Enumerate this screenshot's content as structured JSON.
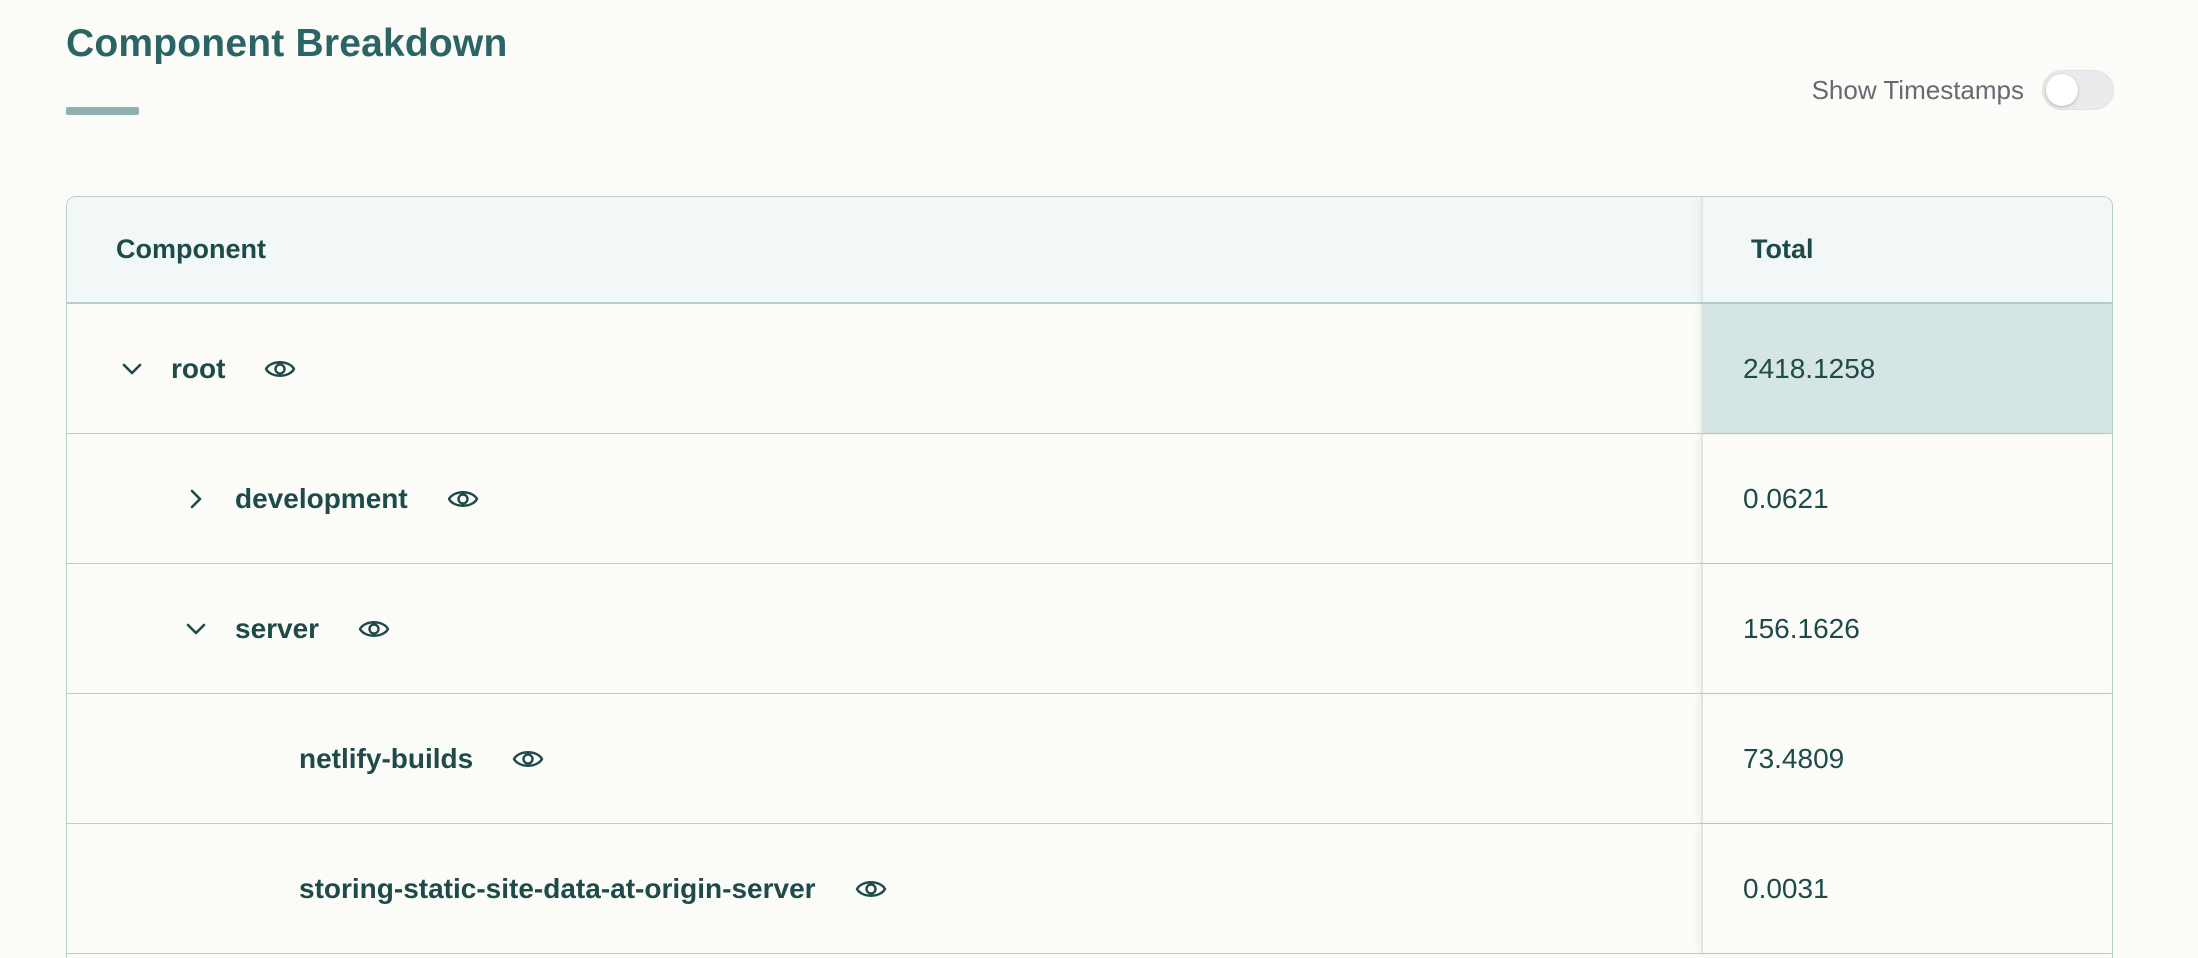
{
  "header": {
    "title": "Component Breakdown",
    "toggle_label": "Show Timestamps",
    "toggle_on": false
  },
  "table": {
    "columns": [
      "Component",
      "Total"
    ],
    "rows": [
      {
        "name": "root",
        "total": "2418.1258",
        "expand": "expanded",
        "level": 0
      },
      {
        "name": "development",
        "total": "0.0621",
        "expand": "collapsed",
        "level": 1
      },
      {
        "name": "server",
        "total": "156.1626",
        "expand": "expanded",
        "level": 1
      },
      {
        "name": "netlify-builds",
        "total": "73.4809",
        "expand": "none",
        "level": 2
      },
      {
        "name": "storing-static-site-data-at-origin-server",
        "total": "0.0031",
        "expand": "none",
        "level": 2
      }
    ]
  },
  "colors": {
    "accent": "#2a6464",
    "highlight": "#d4e5e3",
    "border": "#b9cfcf"
  }
}
